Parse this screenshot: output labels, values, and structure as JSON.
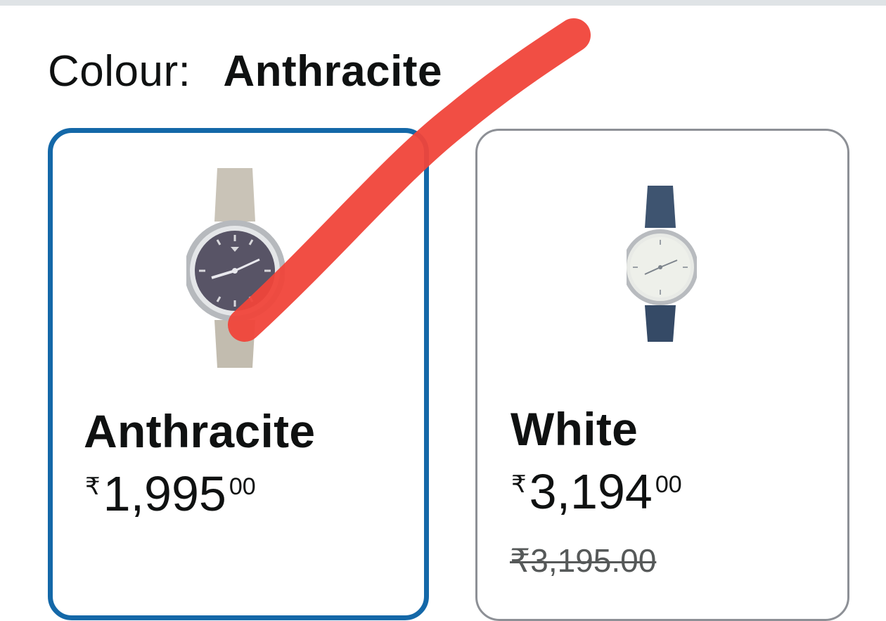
{
  "colour_selector": {
    "label": "Colour:",
    "selected_value": "Anthracite"
  },
  "swatches": [
    {
      "name": "Anthracite",
      "currency": "₹",
      "price_whole": "1,995",
      "price_fraction": "00",
      "selected": true,
      "dial_color": "#585466",
      "strap_color": "#c9c3b7"
    },
    {
      "name": "White",
      "currency": "₹",
      "price_whole": "3,194",
      "price_fraction": "00",
      "list_price": "₹3,195.00",
      "selected": false,
      "dial_color": "#eef0ea",
      "strap_color": "#3e5470"
    }
  ],
  "colors": {
    "selected_border": "#1468a8",
    "unselected_border": "#8d9096",
    "annotation_stroke": "#f0453a"
  }
}
